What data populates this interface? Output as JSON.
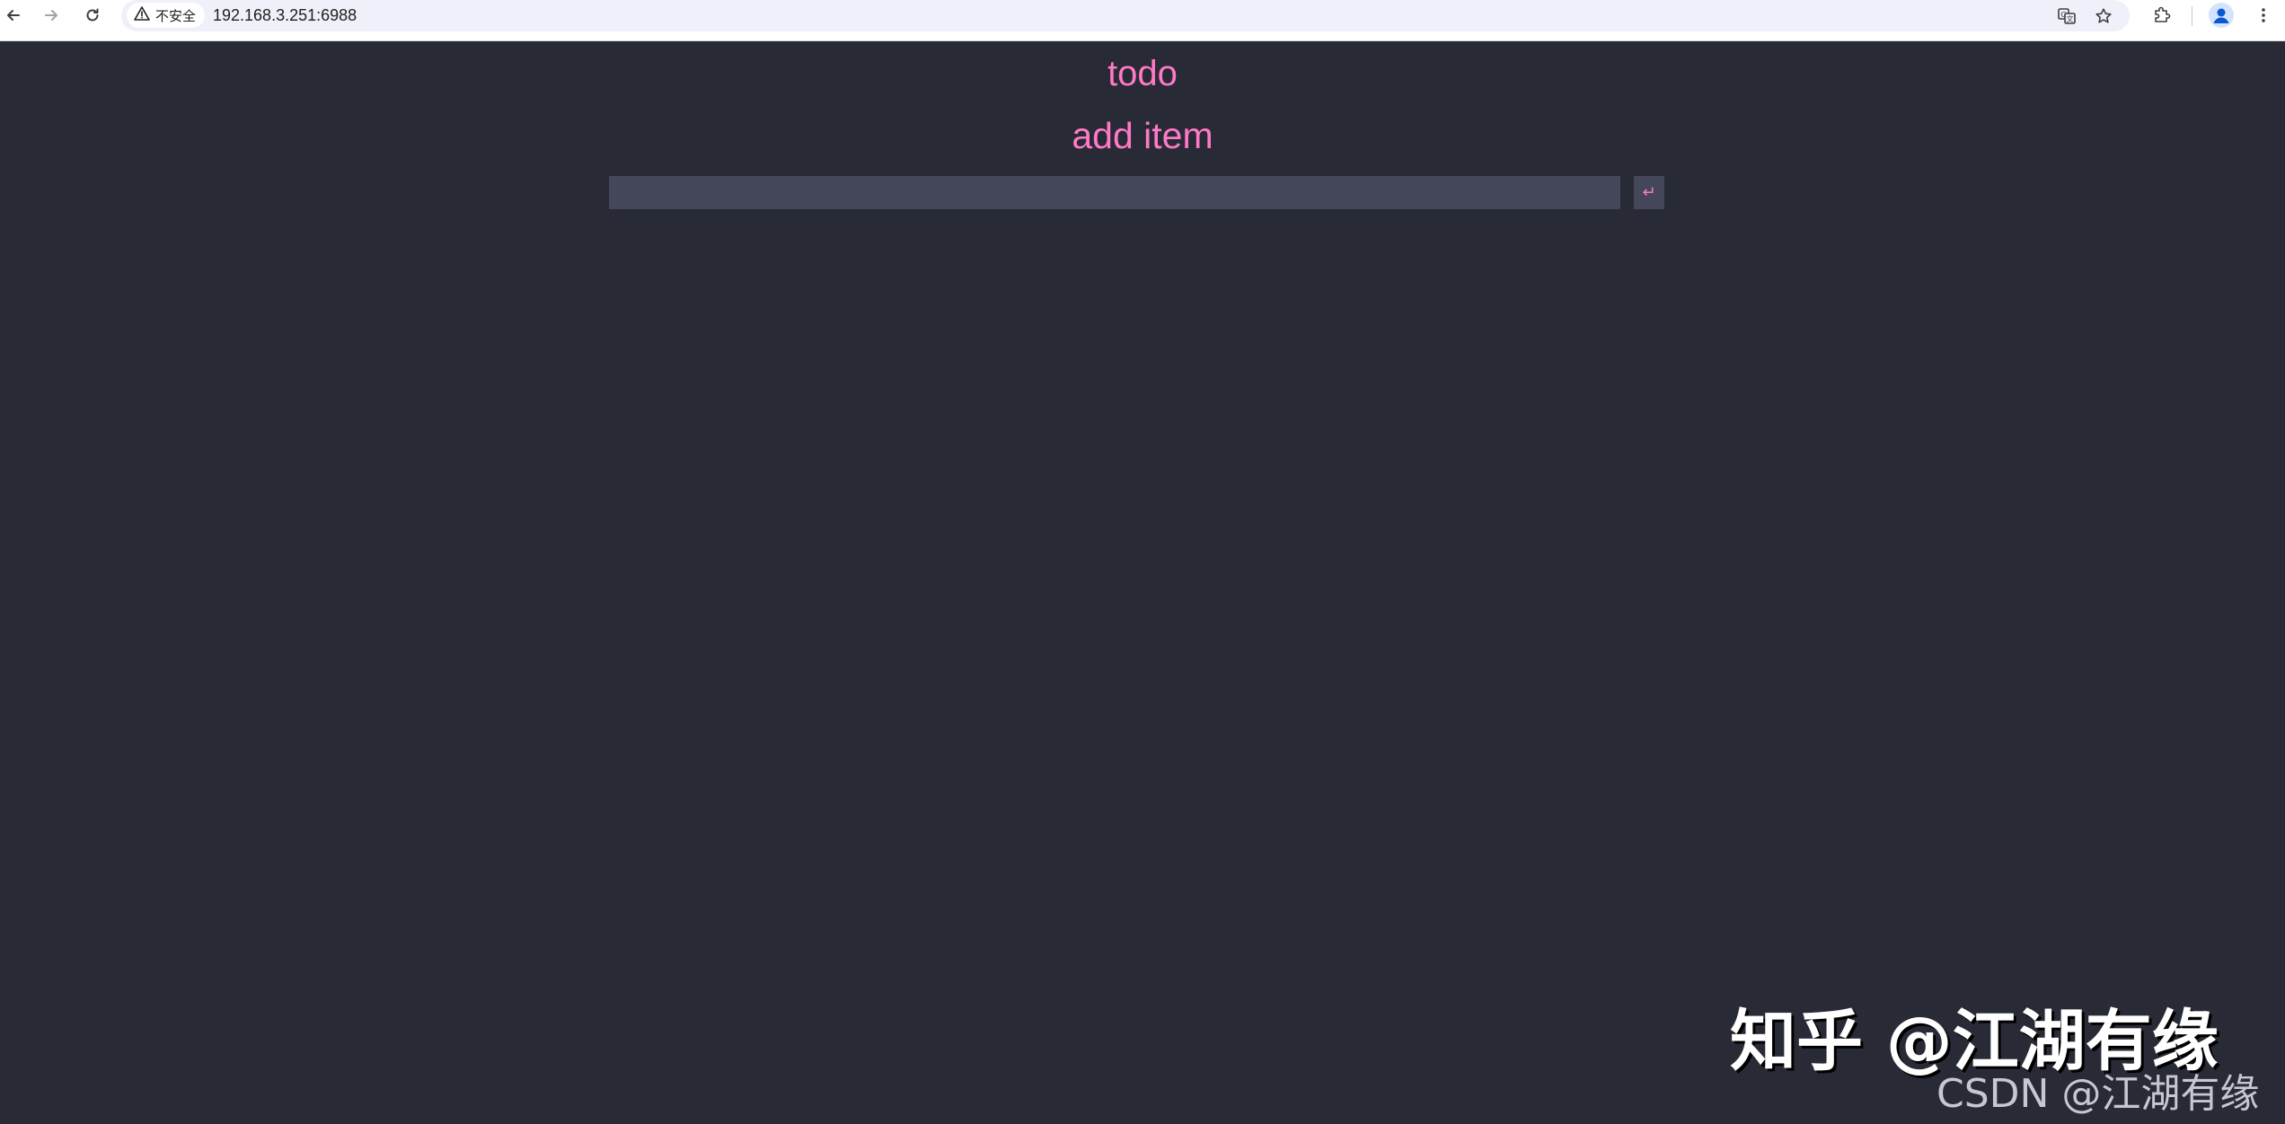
{
  "browser": {
    "security_label": "不安全",
    "url": "192.168.3.251:6988",
    "icons": [
      "back-icon",
      "forward-icon",
      "reload-icon",
      "warning-icon",
      "translate-icon",
      "star-icon",
      "extensions-icon",
      "profile-icon",
      "menu-icon"
    ]
  },
  "app": {
    "title": "todo",
    "subtitle": "add item",
    "input_value": "",
    "submit_label": "↵",
    "colors": {
      "background": "#282a36",
      "accent": "#ff79c6",
      "input_background": "#44475a"
    }
  },
  "watermark": {
    "main": "知乎 @江湖有缘",
    "sub": "CSDN @江湖有缘"
  }
}
